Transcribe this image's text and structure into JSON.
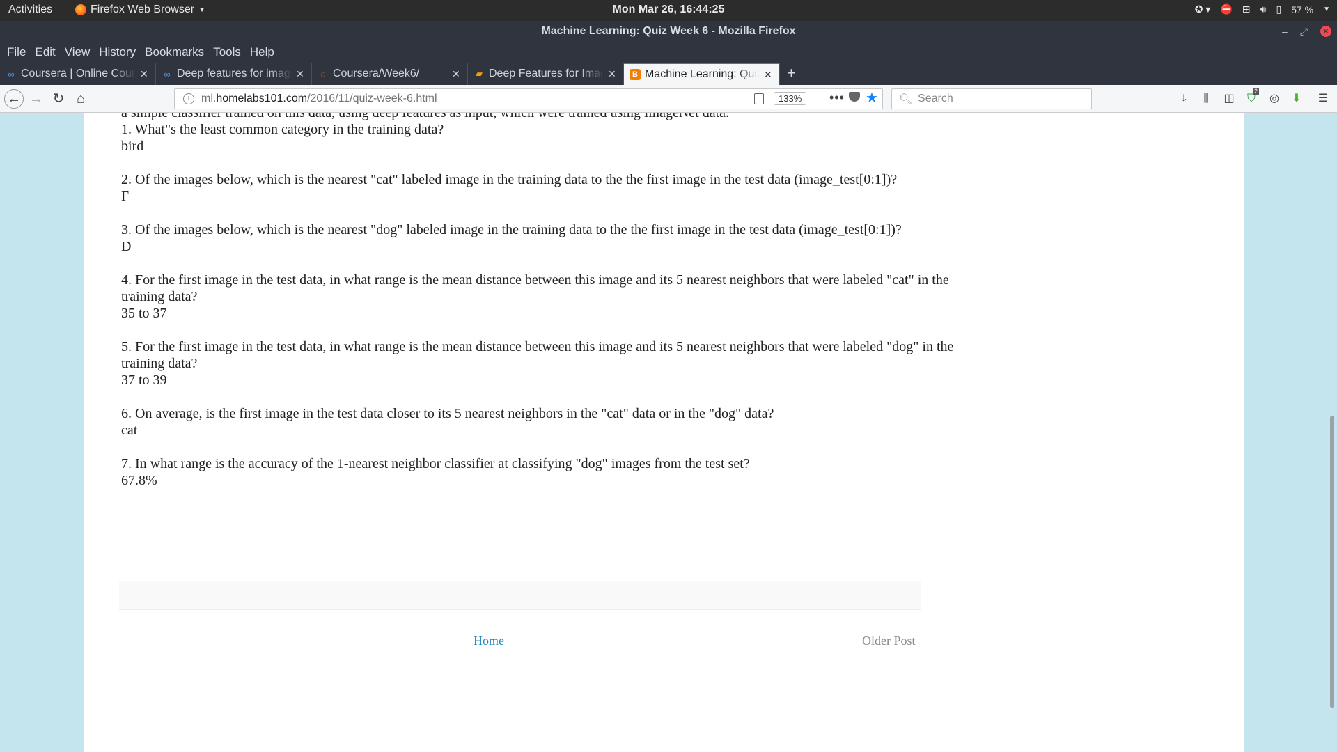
{
  "topbar": {
    "activities": "Activities",
    "app_name": "Firefox Web Browser",
    "clock": "Mon Mar 26, 16:44:25",
    "battery": "57 %"
  },
  "window": {
    "title": "Machine Learning: Quiz Week 6 - Mozilla Firefox"
  },
  "menu": [
    "File",
    "Edit",
    "View",
    "History",
    "Bookmarks",
    "Tools",
    "Help"
  ],
  "tabs": [
    {
      "label": "Coursera | Online Courses",
      "icon": "coursera-icon",
      "active": false
    },
    {
      "label": "Deep features for image",
      "icon": "coursera-icon",
      "active": false
    },
    {
      "label": "Coursera/Week6/",
      "icon": "jupyter-icon",
      "active": false
    },
    {
      "label": "Deep Features for Image",
      "icon": "notebook-icon",
      "active": false
    },
    {
      "label": "Machine Learning: Quiz",
      "icon": "blogger-icon",
      "active": true
    }
  ],
  "navbar": {
    "url_prefix": "ml.",
    "url_host": "homelabs101.com",
    "url_path": "/2016/11/quiz-week-6.html",
    "zoom": "133%",
    "search_placeholder": "Search",
    "badge_count": "2"
  },
  "post": {
    "intro": "a simple classifier trained on this data, using deep features as input, which were trained using ImageNet data.",
    "questions": [
      {
        "q": "1. What\"s the least common category in the training data?",
        "a": "bird"
      },
      {
        "q": "2. Of the images below, which is the nearest \"cat\" labeled image in the training data to the the first image in the test data (image_test[0:1])?",
        "a": "F"
      },
      {
        "q": "3. Of the images below, which is the nearest \"dog\" labeled image in the training data to the the first image in the test data (image_test[0:1])?",
        "a": "D"
      },
      {
        "q": "4. For the first image in the test data, in what range is the mean distance between this image and its 5 nearest neighbors that were labeled \"cat\" in the training data?",
        "a": "35 to 37"
      },
      {
        "q": "5. For the first image in the test data, in what range is the mean distance between this image and its 5 nearest neighbors that were labeled \"dog\" in the training data?",
        "a": "37 to 39"
      },
      {
        "q": "6. On average, is the first image in the test data closer to its 5 nearest neighbors in the \"cat\" data or in the \"dog\" data?",
        "a": "cat"
      },
      {
        "q": "7. In what range is the accuracy of the 1-nearest neighbor classifier at classifying \"dog\" images from the test set?",
        "a": "67.8%"
      }
    ]
  },
  "footer": {
    "home": "Home",
    "older": "Older Post"
  },
  "colors": {
    "page_background": "#c4e4ee",
    "link": "#2288bb",
    "active_tab_accent": "#0a84ff"
  }
}
